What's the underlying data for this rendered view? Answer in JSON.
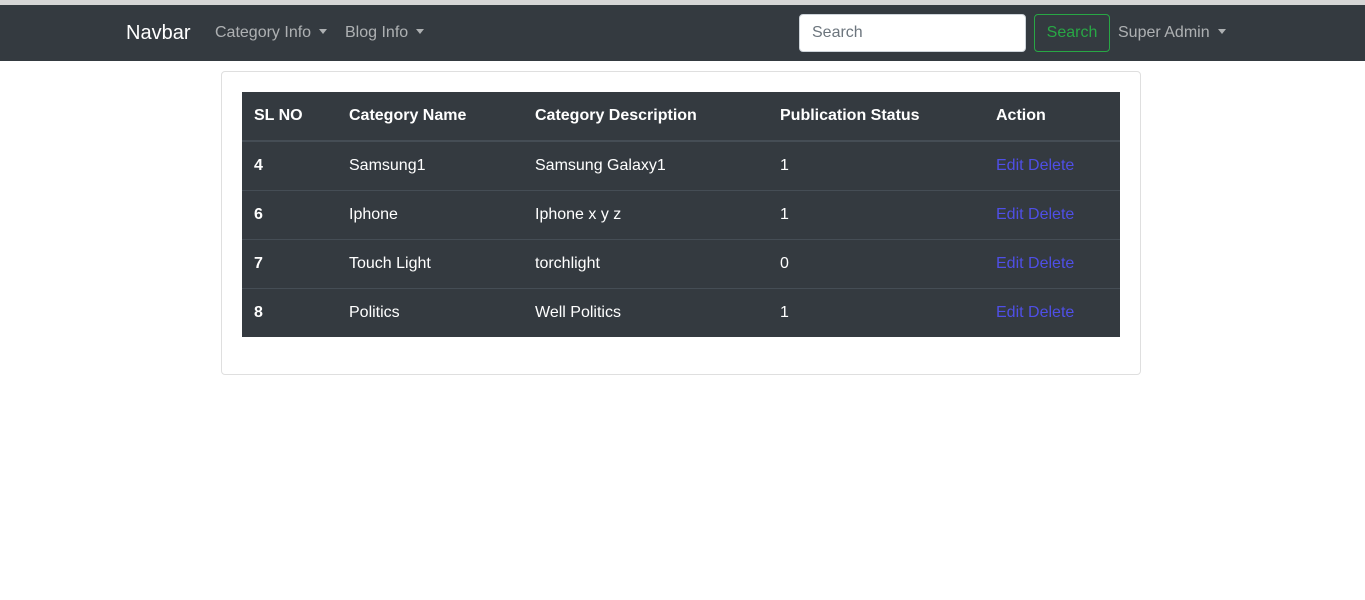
{
  "navbar": {
    "brand": "Navbar",
    "category_menu": "Category Info",
    "blog_menu": "Blog Info",
    "search_placeholder": "Search",
    "search_button": "Search",
    "user_menu": "Super Admin"
  },
  "table": {
    "headers": [
      "SL NO",
      "Category Name",
      "Category Description",
      "Publication Status",
      "Action"
    ],
    "rows": [
      {
        "sl": "4",
        "name": "Samsung1",
        "description": "Samsung Galaxy1",
        "status": "1",
        "edit": "Edit",
        "delete": "Delete"
      },
      {
        "sl": "6",
        "name": "Iphone",
        "description": "Iphone x y z",
        "status": "1",
        "edit": "Edit",
        "delete": "Delete"
      },
      {
        "sl": "7",
        "name": "Touch Light",
        "description": "torchlight",
        "status": "0",
        "edit": "Edit",
        "delete": "Delete"
      },
      {
        "sl": "8",
        "name": "Politics",
        "description": "Well Politics",
        "status": "1",
        "edit": "Edit",
        "delete": "Delete"
      }
    ]
  },
  "colors": {
    "navbar_bg": "#343a40",
    "table_bg": "#343a40",
    "link": "#4f4fe6",
    "success": "#28a745"
  }
}
